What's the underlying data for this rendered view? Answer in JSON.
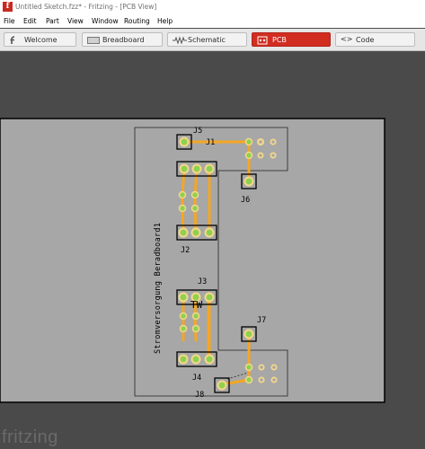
{
  "window": {
    "title": "Untitled Sketch.fzz* - Fritzing - [PCB View]",
    "app_icon": "f"
  },
  "menu": [
    "File",
    "Edit",
    "Part",
    "View",
    "Window",
    "Routing",
    "Help"
  ],
  "tabs": [
    {
      "label": "Welcome",
      "icon": "fritzing-icon"
    },
    {
      "label": "Breadboard",
      "icon": "breadboard-icon"
    },
    {
      "label": "Schematic",
      "icon": "schematic-icon"
    },
    {
      "label": "PCB",
      "icon": "pcb-icon",
      "active": true
    },
    {
      "label": "Code",
      "icon": "code-icon"
    }
  ],
  "pcb": {
    "board_label": "Stromversorgung Beradboard1",
    "logo_text": "TW",
    "connectors": {
      "j1": "J1",
      "j2": "J2",
      "j3": "J3",
      "j4": "J4",
      "j5": "J5",
      "j6": "J6",
      "j7": "J7",
      "j8": "J8"
    },
    "colors": {
      "background": "#4a4a4a",
      "board": "#a7a7a7",
      "trace": "#f5a623",
      "via": "#8fd14f",
      "pad": "#f5d88a"
    }
  },
  "footer": {
    "logo": "fritzing"
  }
}
